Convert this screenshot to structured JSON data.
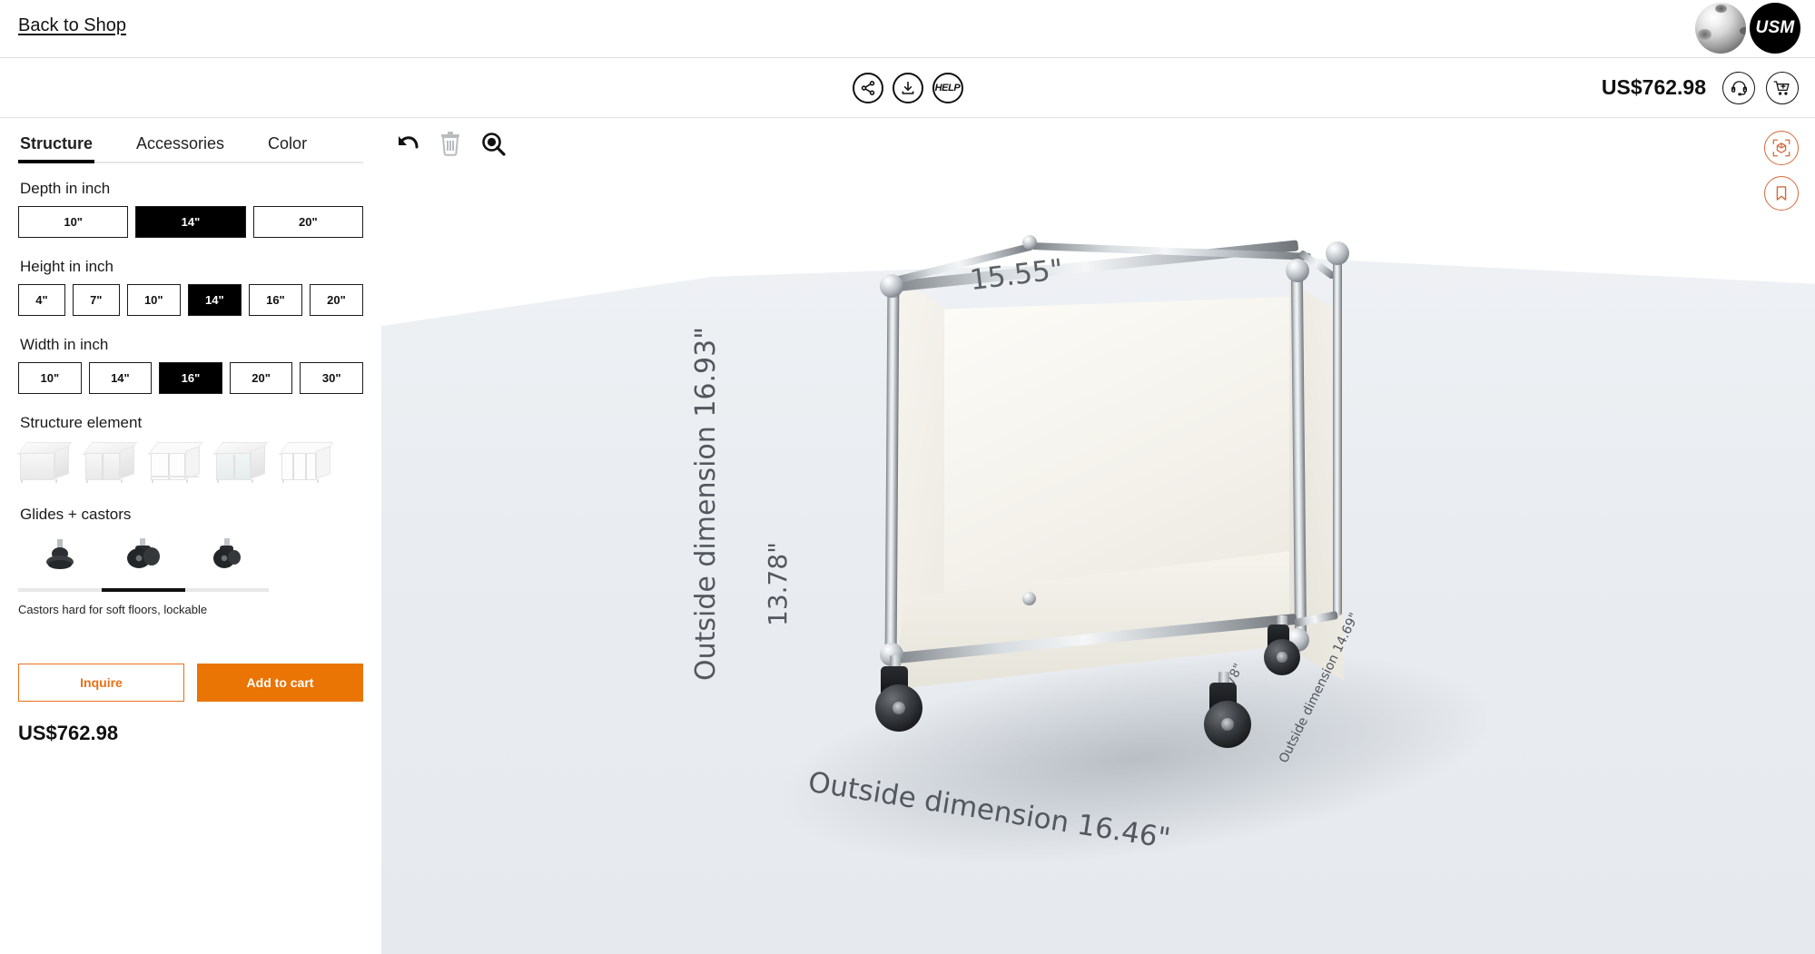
{
  "top_bar": {
    "back_link": "Back to Shop",
    "brand_name": "USM",
    "ball_icon": "usm-chrome-ball-icon"
  },
  "action_bar": {
    "tools": [
      {
        "name": "share-icon",
        "label": ""
      },
      {
        "name": "download-icon",
        "label": ""
      },
      {
        "name": "help-icon",
        "label": "HELP"
      }
    ],
    "price": "US$762.98",
    "support_icon": "headset-icon",
    "cart_icon": "add-to-cart-icon"
  },
  "sidebar": {
    "tabs": [
      {
        "label": "Structure",
        "active": true
      },
      {
        "label": "Accessories",
        "active": false
      },
      {
        "label": "Color",
        "active": false
      }
    ],
    "depth": {
      "label": "Depth in inch",
      "options": [
        "10\"",
        "14\"",
        "20\""
      ],
      "selected": "14\""
    },
    "height": {
      "label": "Height in inch",
      "options": [
        "4\"",
        "7\"",
        "10\"",
        "14\"",
        "16\"",
        "20\""
      ],
      "selected": "14\""
    },
    "width": {
      "label": "Width in inch",
      "options": [
        "10\"",
        "14\"",
        "16\"",
        "20\"",
        "30\""
      ],
      "selected": "16\""
    },
    "structure_element": {
      "label": "Structure element",
      "options": [
        "closed-box-element",
        "open-front-element",
        "open-frame-element",
        "panel-element",
        "divided-frame-element"
      ],
      "selected_index": -1
    },
    "glides": {
      "label": "Glides + castors",
      "options": [
        "glide-foot",
        "castor-soft-floor-lockable",
        "castor-hard-floor"
      ],
      "selected_index": 1,
      "caption": "Castors hard for soft floors, lockable"
    },
    "inquire_label": "Inquire",
    "add_to_cart_label": "Add to cart",
    "price": "US$762.98"
  },
  "canvas": {
    "toolbar": [
      {
        "name": "undo-icon",
        "enabled": true
      },
      {
        "name": "delete-icon",
        "enabled": false
      },
      {
        "name": "zoom-reset-icon",
        "enabled": true
      }
    ],
    "right_tools": [
      {
        "name": "ar-view-icon"
      },
      {
        "name": "bookmark-icon"
      }
    ],
    "dimensions": {
      "top": "15.55\"",
      "left_outside": "Outside dimension 16.93\"",
      "left_inner": "13.78\"",
      "bottom_outside": "Outside dimension 16.46\"",
      "right_inner": "13.78\"",
      "right_outside": "Outside dimension 14.69\""
    }
  },
  "colors": {
    "accent_orange": "#ea7404",
    "accent_orange_light": "#d4693c",
    "selected_black": "#000000",
    "floor": "#e9edf1"
  }
}
